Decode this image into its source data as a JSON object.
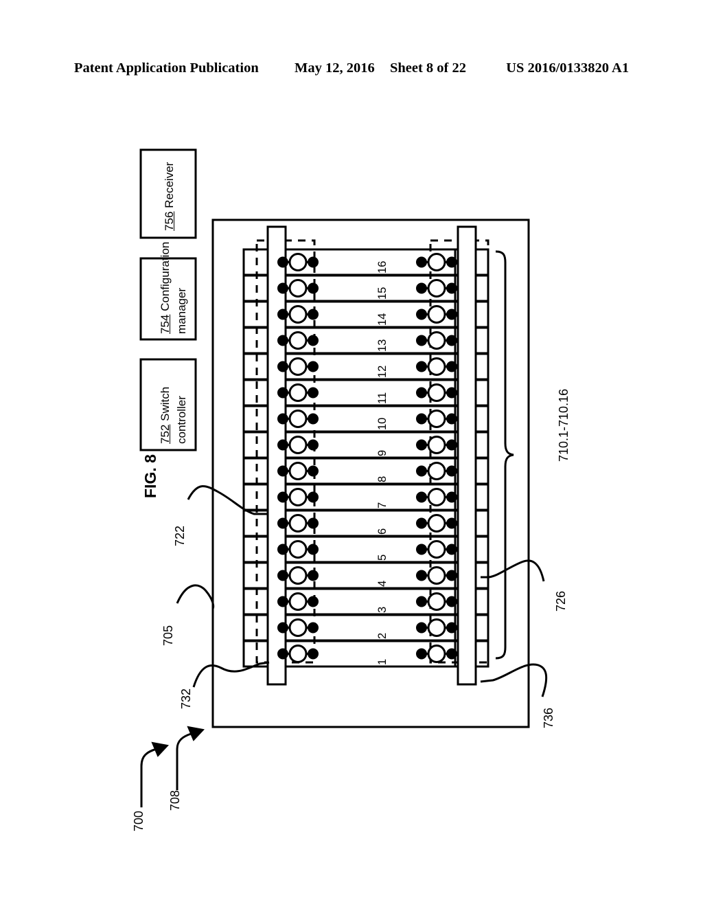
{
  "header": {
    "publication": "Patent Application Publication",
    "date": "May 12, 2016",
    "sheet": "Sheet 8 of 22",
    "patent_number": "US 2016/0133820 A1"
  },
  "figure": {
    "label": "FIG. 8",
    "blocks": [
      {
        "id": "receiver",
        "ref": "756",
        "line1": "Receiver",
        "line2": ""
      },
      {
        "id": "config-mgr",
        "ref": "754",
        "line1": "Configuration",
        "line2": "manager"
      },
      {
        "id": "switch-ctl",
        "ref": "752",
        "line1": "Switch",
        "line2": "controller"
      }
    ],
    "callouts": [
      {
        "id": "system",
        "ref": "700"
      },
      {
        "id": "switch-fabric",
        "ref": "708"
      },
      {
        "id": "array",
        "ref": "705"
      },
      {
        "id": "left-element",
        "ref": "722"
      },
      {
        "id": "left-bus",
        "ref": "732"
      },
      {
        "id": "right-element",
        "ref": "726"
      },
      {
        "id": "right-bus",
        "ref": "736"
      }
    ],
    "brace_label": "710.1-710.16",
    "row_numbers": [
      "1",
      "2",
      "3",
      "4",
      "5",
      "6",
      "7",
      "8",
      "9",
      "10",
      "11",
      "12",
      "13",
      "14",
      "15",
      "16"
    ],
    "row_count": 16,
    "colors": {
      "ink": "#000000",
      "paper": "#ffffff"
    }
  }
}
